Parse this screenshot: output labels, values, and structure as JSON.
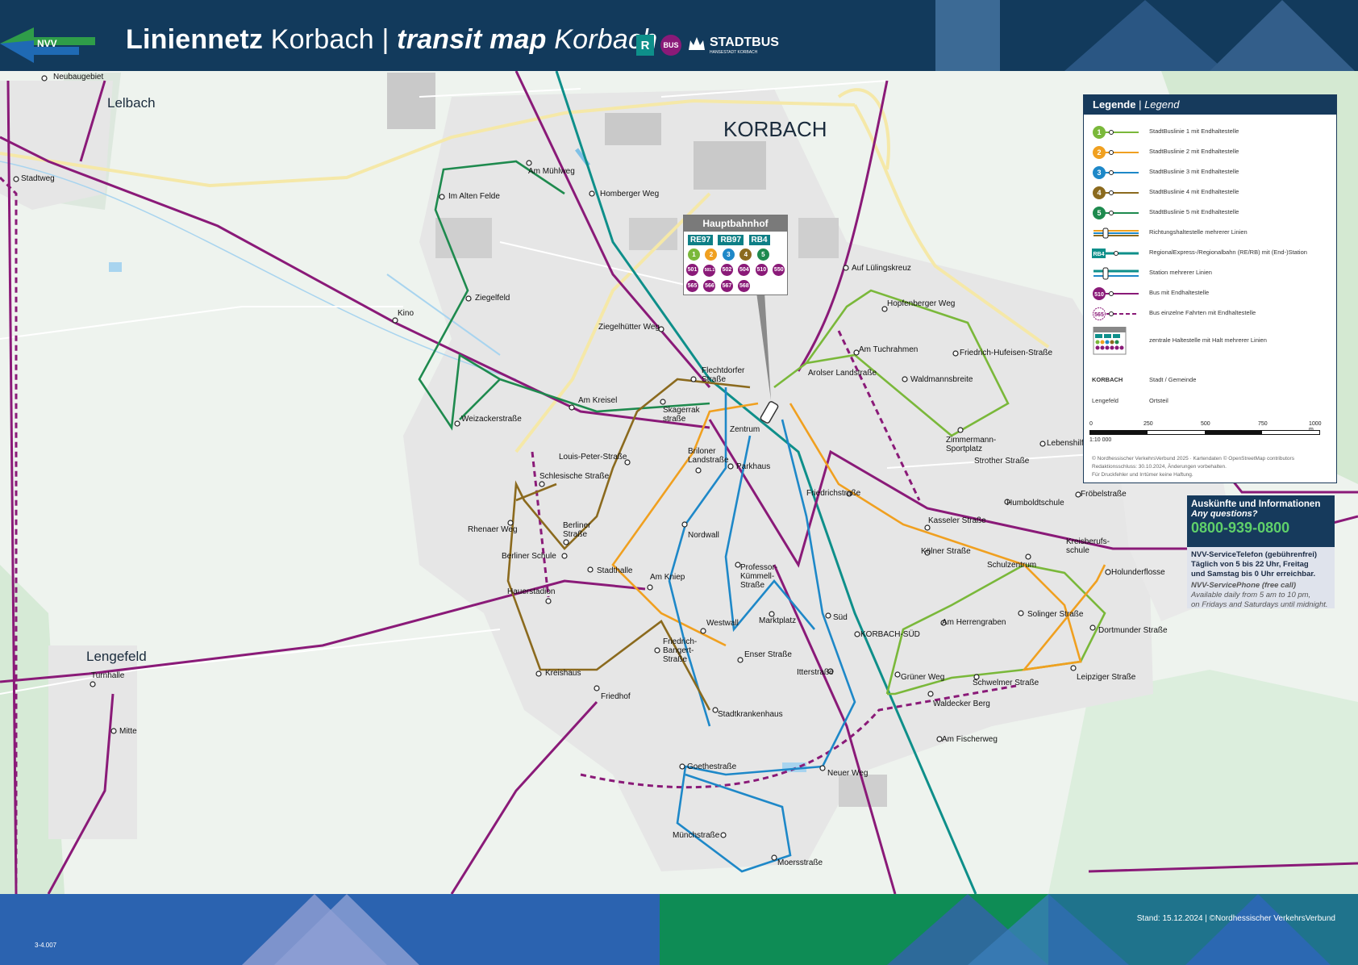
{
  "header": {
    "nvv_logo_text": "NVV",
    "title_bold": "Liniennetz",
    "title_place": "Korbach",
    "title_sep": "|",
    "title_italic": "transit map",
    "title_place2": "Korbach",
    "badge_r": "R",
    "badge_bus": "BUS",
    "stadtbus_logo": "STADTBUS",
    "stadtbus_sub": "HANSESTADT KORBACH"
  },
  "map": {
    "town_label": "KORBACH",
    "districts": [
      {
        "id": "lelbach",
        "label": "Lelbach"
      },
      {
        "id": "lengefeld",
        "label": "Lengefeld"
      }
    ],
    "stops": [
      "Neubaugebiet",
      "Stadtweg",
      "Am Mühlweg",
      "Homberger Weg",
      "Im Alten Felde",
      "Ziegelfeld",
      "Kino",
      "Ziegelhütter Weg",
      "Flechtdorfer Straße",
      "Am Kreisel",
      "Weizackerstraße",
      "Skagerrak straße",
      "Louis-Peter-Straße",
      "Briloner Landstraße",
      "Parkhaus",
      "Zentrum",
      "Schlesische Straße",
      "Rhenaer Weg",
      "Berliner Straße",
      "Berliner Schule",
      "Stadthalle",
      "Hauerstadion",
      "Am Kniep",
      "Nordwall",
      "Kreishaus",
      "Friedhof",
      "Westwall",
      "Friedrich-Bangert-Straße",
      "Marktplatz",
      "Professor-Kümmell-Straße",
      "Enser Straße",
      "Stadtkrankenhaus",
      "Itterstraße",
      "Süd",
      "KORBACH-SÜD",
      "Goethestraße",
      "Neuer Weg",
      "Münchstraße",
      "Moersstraße",
      "Auf Lülingskreuz",
      "Hopfenberger Weg",
      "Am Tuchrahmen",
      "Friedrich-Hufeisen-Straße",
      "Arolser Landstraße",
      "Waldmannsbreite",
      "Zimmermann-Sportplatz",
      "Friedrichstraße",
      "Kasseler Straße",
      "Kölner Straße",
      "Humboldtschule",
      "Lebenshilfe",
      "Fröbelstraße",
      "Schulzentrum",
      "Kreisberufs-schule",
      "Holunderflosse",
      "Solinger Straße",
      "Am Herrengraben",
      "Dortmunder Straße",
      "Grüner Weg",
      "Schwelmer Straße",
      "Leipziger Straße",
      "Waldecker Berg",
      "Am Fischerweg",
      "Turnhalle",
      "Mitte",
      "Strother Straße"
    ],
    "hauptbahnhof": {
      "title": "Hauptbahnhof",
      "trains": [
        "RE97",
        "RB97",
        "RB4"
      ],
      "citylines": [
        "1",
        "2",
        "3",
        "4",
        "5"
      ],
      "buses": [
        "501",
        "501.1",
        "502",
        "504",
        "510",
        "550",
        "565",
        "566",
        "567",
        "568"
      ]
    }
  },
  "legend": {
    "title": "Legende",
    "title_en": "Legend",
    "rows": [
      {
        "sym": "1",
        "text": "StadtBuslinie 1 mit Endhaltestelle"
      },
      {
        "sym": "2",
        "text": "StadtBuslinie 2 mit Endhaltestelle"
      },
      {
        "sym": "3",
        "text": "StadtBuslinie 3 mit Endhaltestelle"
      },
      {
        "sym": "4",
        "text": "StadtBuslinie 4 mit Endhaltestelle"
      },
      {
        "sym": "5",
        "text": "StadtBuslinie 5 mit Endhaltestelle"
      },
      {
        "sym": "dir",
        "text": "Richtungshaltestelle mehrerer Linien"
      },
      {
        "sym": "RB4",
        "text": "RegionalExpress-/Regionalbahn (RE/RB) mit (End-)Station"
      },
      {
        "sym": "station",
        "text": "Station mehrerer Linien"
      },
      {
        "sym": "510",
        "text": "Bus mit Endhaltestelle"
      },
      {
        "sym": "565",
        "text": "Bus einzelne Fahrten mit Endhaltestelle"
      },
      {
        "sym": "hub",
        "text": "zentrale Haltestelle mit Halt mehrerer Linien"
      },
      {
        "sym": "KORBACH",
        "text": "Stadt / Gemeinde"
      },
      {
        "sym": "Lengefeld",
        "text": "Ortsteil"
      }
    ],
    "scale_ticks": [
      "0",
      "250",
      "500",
      "750",
      "1000 m"
    ],
    "scale_ratio": "1:10 000",
    "credit1": "© Nordhessischer VerkehrsVerbund 2025 · Kartendaten © OpenStreetMap contributors",
    "credit2": "Redaktionsschluss: 30.10.2024, Änderungen vorbehalten.",
    "credit3": "Für Druckfehler und Irrtümer keine Haftung."
  },
  "info": {
    "title": "Auskünfte und Informationen",
    "title_en": "Any questions?",
    "phone": "0800-939-0800",
    "service_bold": "NVV-ServiceTelefon (gebührenfrei)",
    "service_line1": "Täglich von 5 bis 22 Uhr, Freitag",
    "service_line2": "und Samstag bis 0 Uhr erreichbar.",
    "service_en1": "NVV-ServicePhone (free call)",
    "service_en2": "Available daily from 5 am to 10 pm,",
    "service_en3": "on Fridays and Saturdays until midnight."
  },
  "footer": {
    "stand": "Stand: 15.12.2024 | ©Nordhessischer VerkehrsVerbund",
    "code": "3-4.007"
  },
  "colors": {
    "line1": "#7ab83a",
    "line2": "#f0a020",
    "line3": "#1e88c8",
    "line4": "#8b6a1e",
    "line5": "#1e8a4e",
    "bus": "#8a1a78",
    "rail": "#0e8f8a",
    "header": "#123a5c"
  }
}
